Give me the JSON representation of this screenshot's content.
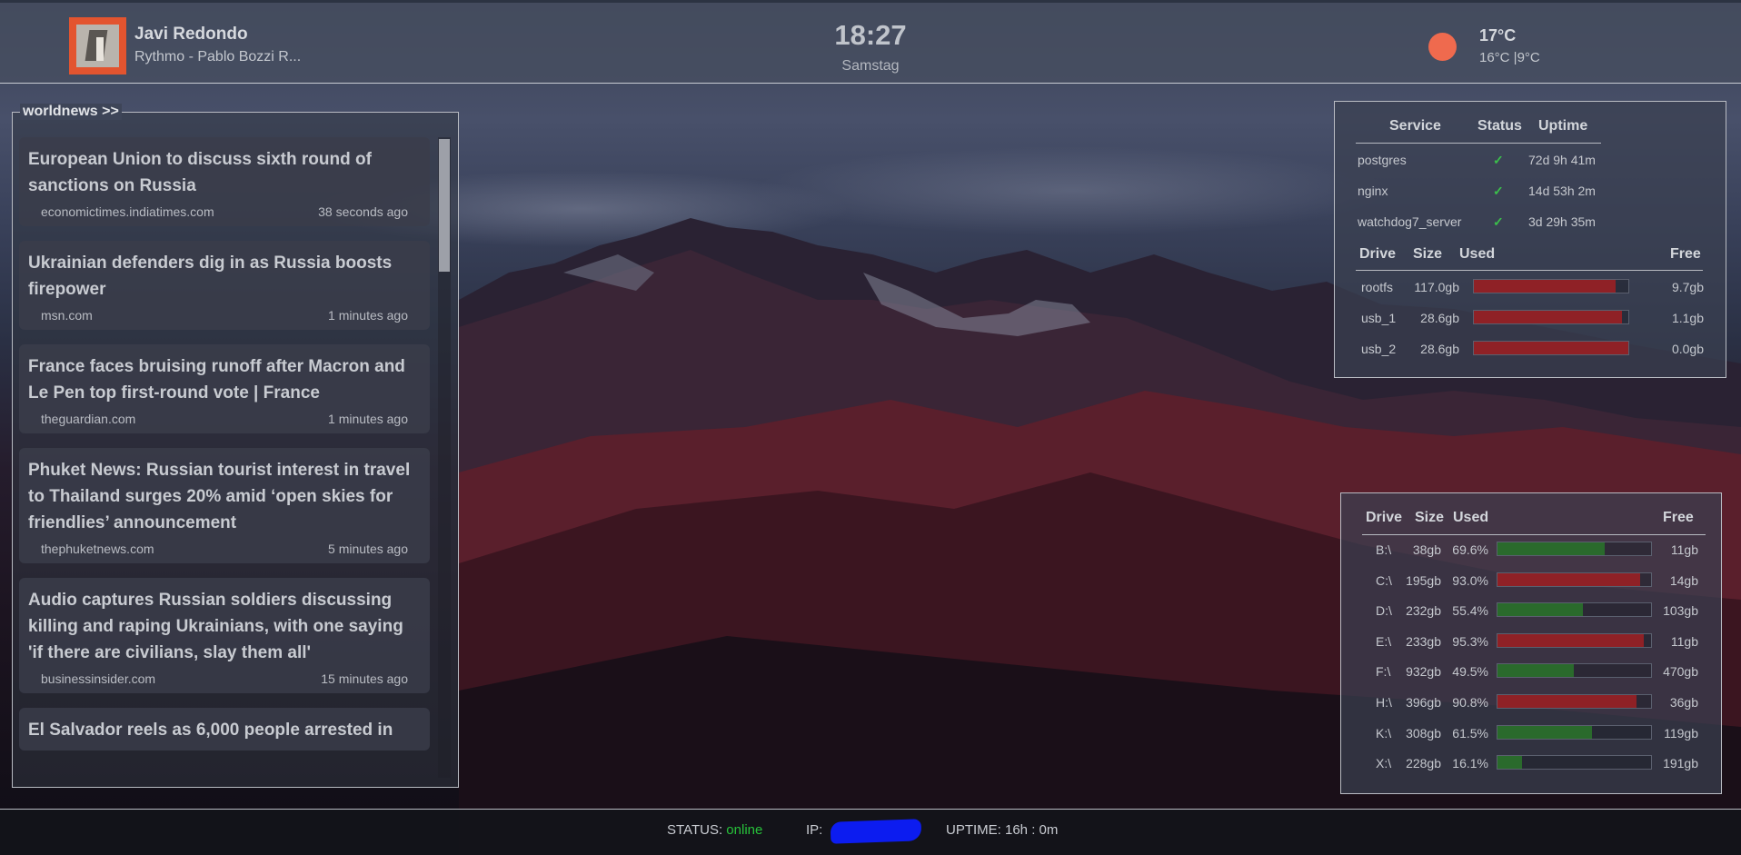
{
  "media": {
    "artist": "Javi Redondo",
    "track": "Rythmo - Pablo Bozzi R..."
  },
  "clock": {
    "time": "18:27",
    "day": "Samstag"
  },
  "weather": {
    "icon": "sun-icon",
    "temp": "17°C",
    "range": "16°C |9°C",
    "sun_color": "#ef6a4e"
  },
  "news": {
    "title": "worldnews >>",
    "items": [
      {
        "title": "European Union to discuss sixth round of sanctions on Russia",
        "source": "economictimes.indiatimes.com",
        "time": "38 seconds ago"
      },
      {
        "title": "Ukrainian defenders dig in as Russia boosts firepower",
        "source": "msn.com",
        "time": "1 minutes ago"
      },
      {
        "title": "France faces bruising runoff after Macron and Le Pen top first-round vote | France",
        "source": "theguardian.com",
        "time": "1 minutes ago"
      },
      {
        "title": "Phuket News: Russian tourist interest in travel to Thailand surges 20% amid ‘open skies for friendlies’ announcement",
        "source": "thephuketnews.com",
        "time": "5 minutes ago"
      },
      {
        "title": "Audio captures Russian soldiers discussing killing and raping Ukrainians, with one saying 'if there are civilians, slay them all'",
        "source": "businessinsider.com",
        "time": "15 minutes ago"
      },
      {
        "title": "El Salvador reels as 6,000 people arrested in",
        "source": "",
        "time": ""
      }
    ]
  },
  "services": {
    "headers": {
      "service": "Service",
      "status": "Status",
      "uptime": "Uptime"
    },
    "rows": [
      {
        "name": "postgres",
        "status": "✓",
        "uptime": "72d 9h 41m"
      },
      {
        "name": "nginx",
        "status": "✓",
        "uptime": "14d 53h 2m"
      },
      {
        "name": "watchdog7_server",
        "status": "✓",
        "uptime": "3d 29h 35m"
      }
    ]
  },
  "server_drives": {
    "headers": {
      "drive": "Drive",
      "size": "Size",
      "used": "Used",
      "free": "Free"
    },
    "rows": [
      {
        "drive": "rootfs",
        "size": "117.0gb",
        "used": "92%",
        "used_fraction": 0.92,
        "free": "9.7gb",
        "color": "#8f2126"
      },
      {
        "drive": "usb_1",
        "size": "28.6gb",
        "used": "96%",
        "used_fraction": 0.96,
        "free": "1.1gb",
        "color": "#8f2126"
      },
      {
        "drive": "usb_2",
        "size": "28.6gb",
        "used": "100%",
        "used_fraction": 1.0,
        "free": "0.0gb",
        "color": "#8f2126"
      }
    ]
  },
  "local_drives": {
    "headers": {
      "drive": "Drive",
      "size": "Size",
      "used": "Used",
      "free": "Free"
    },
    "rows": [
      {
        "drive": "B:\\",
        "size": "38gb",
        "used": "69.6%",
        "used_fraction": 0.696,
        "free": "11gb",
        "color": "#2a6a2c"
      },
      {
        "drive": "C:\\",
        "size": "195gb",
        "used": "93.0%",
        "used_fraction": 0.93,
        "free": "14gb",
        "color": "#8f2126"
      },
      {
        "drive": "D:\\",
        "size": "232gb",
        "used": "55.4%",
        "used_fraction": 0.554,
        "free": "103gb",
        "color": "#2a6a2c"
      },
      {
        "drive": "E:\\",
        "size": "233gb",
        "used": "95.3%",
        "used_fraction": 0.953,
        "free": "11gb",
        "color": "#8f2126"
      },
      {
        "drive": "F:\\",
        "size": "932gb",
        "used": "49.5%",
        "used_fraction": 0.495,
        "free": "470gb",
        "color": "#2a6a2c"
      },
      {
        "drive": "H:\\",
        "size": "396gb",
        "used": "90.8%",
        "used_fraction": 0.908,
        "free": "36gb",
        "color": "#8f2126"
      },
      {
        "drive": "K:\\",
        "size": "308gb",
        "used": "61.5%",
        "used_fraction": 0.615,
        "free": "119gb",
        "color": "#2a6a2c"
      },
      {
        "drive": "X:\\",
        "size": "228gb",
        "used": "16.1%",
        "used_fraction": 0.161,
        "free": "191gb",
        "color": "#2a6a2c"
      }
    ]
  },
  "status_bar": {
    "status_label": "STATUS:",
    "status_value": "online",
    "ip_label": "IP:",
    "uptime": "UPTIME: 16h : 0m"
  }
}
